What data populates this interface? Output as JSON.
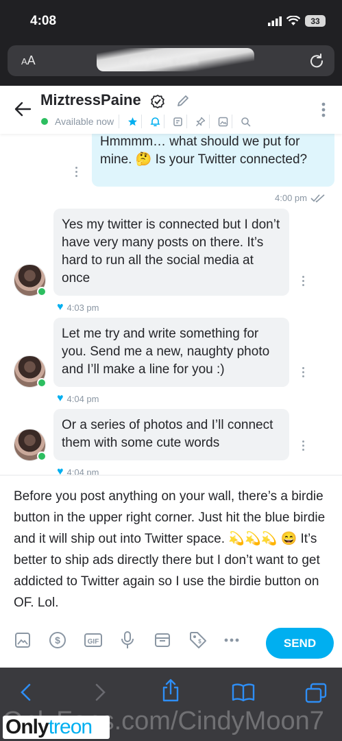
{
  "status_bar": {
    "time": "4:08",
    "battery": "33"
  },
  "browser": {
    "aa_label": "AA",
    "url": "onlyfans.com"
  },
  "chat_header": {
    "username": "MiztressPaine",
    "online_status": "Available now"
  },
  "messages": [
    {
      "direction": "out",
      "text": "Hmmmm… what should we put for mine. 🤔 Is your Twitter connected?",
      "time": "4:00 pm"
    },
    {
      "direction": "in",
      "text": "Yes my twitter is connected but I don’t have very many posts on there. It’s hard to run all the social media at once",
      "time": "4:03 pm"
    },
    {
      "direction": "in",
      "text": "Let me try and write something for you. Send me a new, naughty photo and I’ll make a line for you :)",
      "time": "4:04 pm"
    },
    {
      "direction": "in",
      "text": "Or a series of photos and I’ll connect them with some cute words",
      "time": "4:04 pm"
    }
  ],
  "compose": {
    "text": "Before you post anything on your wall, there’s a birdie button in the upper right corner. Just hit the blue birdie and it will ship out into Twitter space. 💫💫💫 😄 It’s better to ship ads directly there but I don’t want to get addicted to Twitter again so I use the birdie button on OF. Lol.",
    "send_label": "SEND",
    "tools": [
      "image-icon",
      "dollar-icon",
      "gif-icon",
      "microphone-icon",
      "vault-icon",
      "price-tag-icon",
      "more-icon"
    ]
  },
  "watermark": {
    "url": "OnlyFans.com/CindyMoon7",
    "logo_a": "Only",
    "logo_b": "treon"
  },
  "colors": {
    "accent": "#00aff0",
    "online": "#2dbe60",
    "bubble_out": "#dff5fc",
    "bubble_in": "#f0f2f4"
  }
}
